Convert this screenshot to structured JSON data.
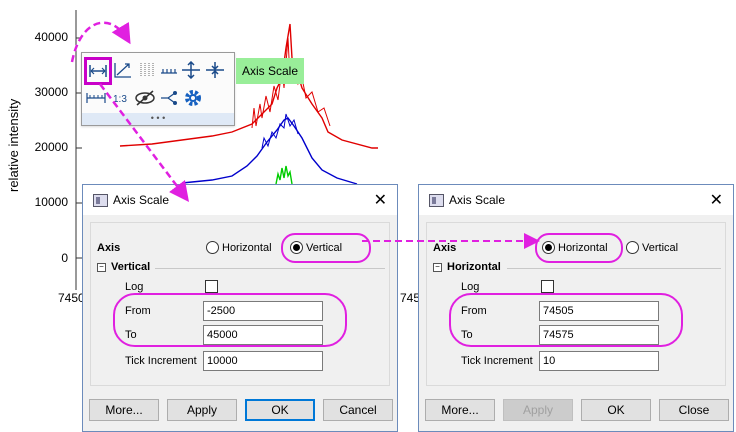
{
  "plot": {
    "ylabel": "relative intensity",
    "yticks": [
      "40000",
      "30000",
      "20000",
      "10000",
      "0"
    ],
    "xticks": [
      "7450",
      "745"
    ]
  },
  "toolbar": {
    "tooltip": "Axis Scale",
    "more": "• • •"
  },
  "dialog_left": {
    "title": "Axis Scale",
    "close": "✕",
    "axis_label": "Axis",
    "radio_horizontal": "Horizontal",
    "radio_vertical": "Vertical",
    "selected": "Vertical",
    "section": "Vertical",
    "log_label": "Log",
    "from_label": "From",
    "from_value": "-2500",
    "to_label": "To",
    "to_value": "45000",
    "tick_label": "Tick Increment",
    "tick_value": "10000",
    "more_btn": "More...",
    "apply_btn": "Apply",
    "ok_btn": "OK",
    "last_btn": "Cancel"
  },
  "dialog_right": {
    "title": "Axis Scale",
    "close": "✕",
    "axis_label": "Axis",
    "radio_horizontal": "Horizontal",
    "radio_vertical": "Vertical",
    "selected": "Horizontal",
    "section": "Horizontal",
    "log_label": "Log",
    "from_label": "From",
    "from_value": "74505",
    "to_label": "To",
    "to_value": "74575",
    "tick_label": "Tick Increment",
    "tick_value": "10",
    "more_btn": "More...",
    "apply_btn": "Apply",
    "ok_btn": "OK",
    "last_btn": "Close"
  },
  "colors": {
    "highlight": "#e020e0",
    "series_red": "#e00000",
    "series_blue": "#0000cc",
    "series_green": "#00cc00"
  }
}
